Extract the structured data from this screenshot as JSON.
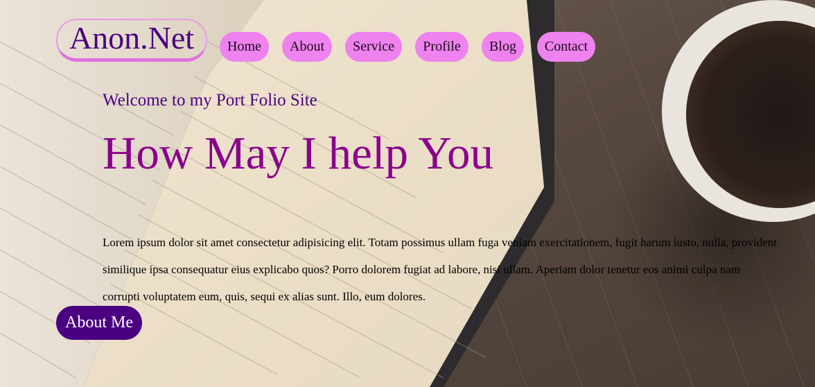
{
  "header": {
    "logo_text": "Anon.Net",
    "nav": [
      {
        "label": "Home"
      },
      {
        "label": "About"
      },
      {
        "label": "Service"
      },
      {
        "label": "Profile"
      },
      {
        "label": "Blog"
      },
      {
        "label": "Contact"
      }
    ]
  },
  "hero": {
    "welcome": "Welcome to my Port Folio Site",
    "headline": "How May I help You",
    "paragraph": "Lorem ipsum dolor sit amet consectetur adipisicing elit. Totam possimus ullam fuga veniam exercitationem, fugit harum iusto, nulla, provident similique ipsa consequatur eius explicabo quos? Porro dolorem fugiat ad labore, nisi ullam. Aperiam dolor tenetur eos animi culpa nam corrupti voluptatem eum, quis, sequi ex alias sunt. Illo, eum dolores.",
    "cta_label": "About Me"
  },
  "colors": {
    "logo_text": "#4b0082",
    "nav_bg": "#ee82ee",
    "welcome_text": "#4b0082",
    "headline_text": "#8b008b",
    "cta_bg": "#4b0082",
    "cta_text": "#ffffff"
  },
  "icons": {
    "background": "notebook-and-coffee-photo"
  }
}
